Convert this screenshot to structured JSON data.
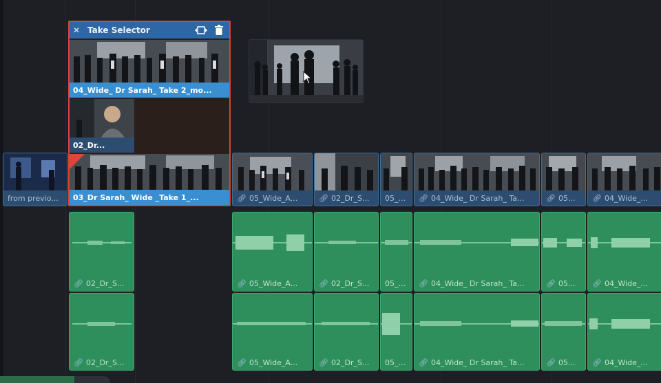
{
  "take_selector": {
    "title": "Take Selector",
    "close_glyph": "✕",
    "takes": [
      {
        "label": "04_Wide_ Dr Sarah_ Take 2_mo..."
      },
      {
        "label": "02_Dr..."
      },
      {
        "label": "03_Dr Sarah_ Wide _Take 1_..."
      }
    ]
  },
  "video_track": {
    "clips": [
      {
        "label": "from previo..."
      },
      {
        "label": "05_Wide_A..."
      },
      {
        "label": "02_Dr_S..."
      },
      {
        "label": "05_..."
      },
      {
        "label": "04_Wide_ Dr Sarah_ Ta..."
      },
      {
        "label": "05..."
      },
      {
        "label": "04_Wide_..."
      }
    ]
  },
  "audio_tracks": [
    {
      "clips": [
        {
          "label": "02_Dr_S..."
        },
        {
          "label": "05_Wide_A..."
        },
        {
          "label": "02_Dr_S..."
        },
        {
          "label": "05_..."
        },
        {
          "label": "04_Wide_ Dr Sarah_ Ta..."
        },
        {
          "label": "05..."
        },
        {
          "label": "04_Wide_..."
        }
      ]
    },
    {
      "clips": [
        {
          "label": "02_Dr_S..."
        },
        {
          "label": "05_Wide_A..."
        },
        {
          "label": "02_Dr_S..."
        },
        {
          "label": "05_..."
        },
        {
          "label": "04_Wide_ Dr Sarah_ Ta..."
        },
        {
          "label": "05..."
        },
        {
          "label": "04_Wide_..."
        }
      ]
    }
  ],
  "icons": {
    "link": "link-icon",
    "close": "close-icon",
    "zoom": "zoom-to-fit-icon",
    "trash": "trash-icon",
    "cursor": "mouse-pointer-icon"
  },
  "colors": {
    "selector_border": "#d9433a",
    "selector_header": "#2e67a6",
    "video_clip": "#2d4d70",
    "audio_clip": "#2e8f5d",
    "selected_take": "#3a8fd0"
  }
}
